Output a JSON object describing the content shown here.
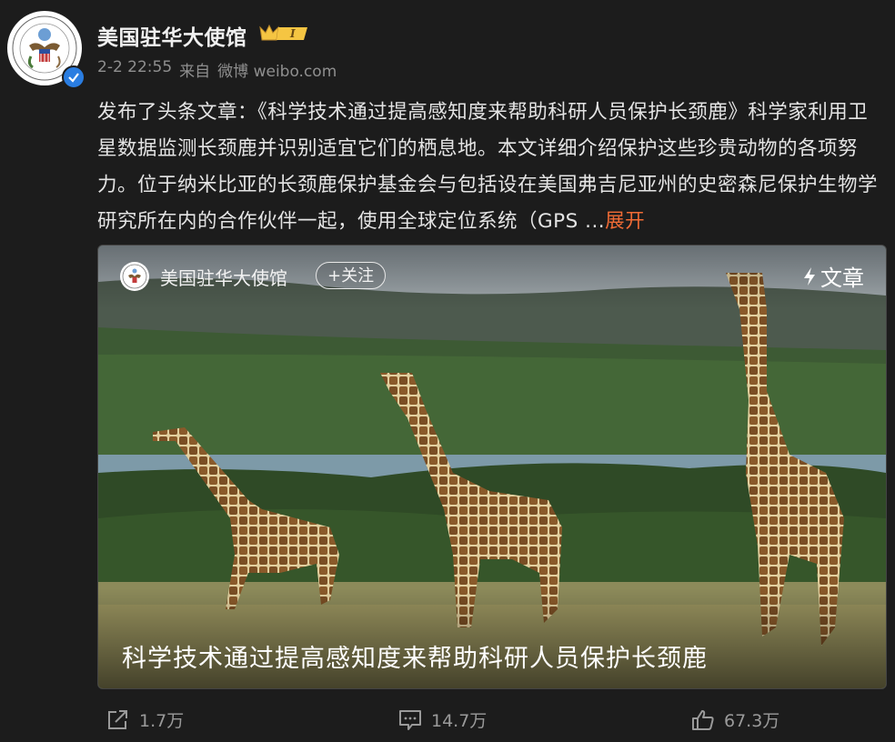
{
  "post": {
    "username": "美国驻华大使馆",
    "badge_level": "I",
    "date": "2-2 22:55",
    "source_prefix": "来自",
    "source_app": "微博 weibo.com",
    "text": "发布了头条文章：《科学技术通过提高感知度来帮助科研人员保护长颈鹿》科学家利用卫星数据监测长颈鹿并识别适宜它们的栖息地。本文详细介绍保护这些珍贵动物的各项努力。位于纳米比亚的长颈鹿保护基金会与包括设在美国弗吉尼亚州的史密森尼保护生物学研究所在内的合作伙伴一起，使用全球定位系统（GPS ...",
    "expand_label": "展开"
  },
  "card": {
    "author": "美国驻华大使馆",
    "follow_label": "+关注",
    "tag_label": "文章",
    "title": "科学技术通过提高感知度来帮助科研人员保护长颈鹿"
  },
  "actions": {
    "share_count": "1.7万",
    "comment_count": "14.7万",
    "like_count": "67.3万"
  },
  "colors": {
    "background": "#1c1c1c",
    "accent": "#f06b35",
    "verified": "#2a7de1",
    "badge": "#f5c542"
  },
  "icons": [
    "verified-icon",
    "crown-badge-icon",
    "lightning-icon",
    "share-icon",
    "comment-icon",
    "like-icon"
  ]
}
